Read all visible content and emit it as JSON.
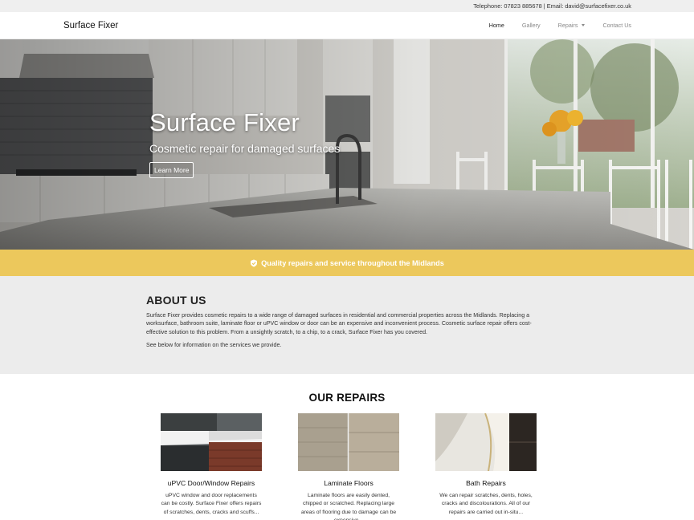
{
  "topbar": {
    "contact": "Telephone: 07823 885678 | Email: david@surfacefixer.co.uk"
  },
  "nav": {
    "brand": "Surface Fixer",
    "items": [
      {
        "label": "Home",
        "active": true
      },
      {
        "label": "Gallery"
      },
      {
        "label": "Repairs",
        "dropdown": true
      },
      {
        "label": "Contact Us"
      }
    ]
  },
  "hero": {
    "title": "Surface Fixer",
    "subtitle": "Cosmetic repair for damaged surfaces",
    "button": "Learn More"
  },
  "banner": {
    "text": "Quality repairs and service throughout the Midlands",
    "icon": "shield-check-icon"
  },
  "about": {
    "heading": "ABOUT US",
    "body": "Surface Fixer provides cosmetic repairs to a wide range of damaged surfaces in residential and commercial properties across the Midlands. Replacing a worksurface, bathroom suite, laminate floor or uPVC window or door can be an expensive and inconvenient process. Cosmetic surface repair offers cost-effective solution to this problem. From a unsightly scratch, to a chip, to a crack, Surface Fixer has you covered.",
    "note": "See below for information on the services we provide."
  },
  "repairs": {
    "heading": "OUR REPAIRS",
    "cards": [
      {
        "title": "uPVC Door/Window Repairs",
        "text": "uPVC window and door replacements can be costly. Surface Fixer offers repairs of scratches, dents, cracks and scuffs..."
      },
      {
        "title": "Laminate Floors",
        "text": "Laminate floors are easily dented, chipped or scratched. Replacing large areas of flooring due to damage can be expensive..."
      },
      {
        "title": "Bath Repairs",
        "text": "We can repair scratches, dents, holes, cracks and discolourations. All of our repairs are carried out in-situ..."
      }
    ]
  },
  "colors": {
    "banner": "#ecc85c",
    "about_bg": "#ececec",
    "topbar_bg": "#efefef"
  }
}
